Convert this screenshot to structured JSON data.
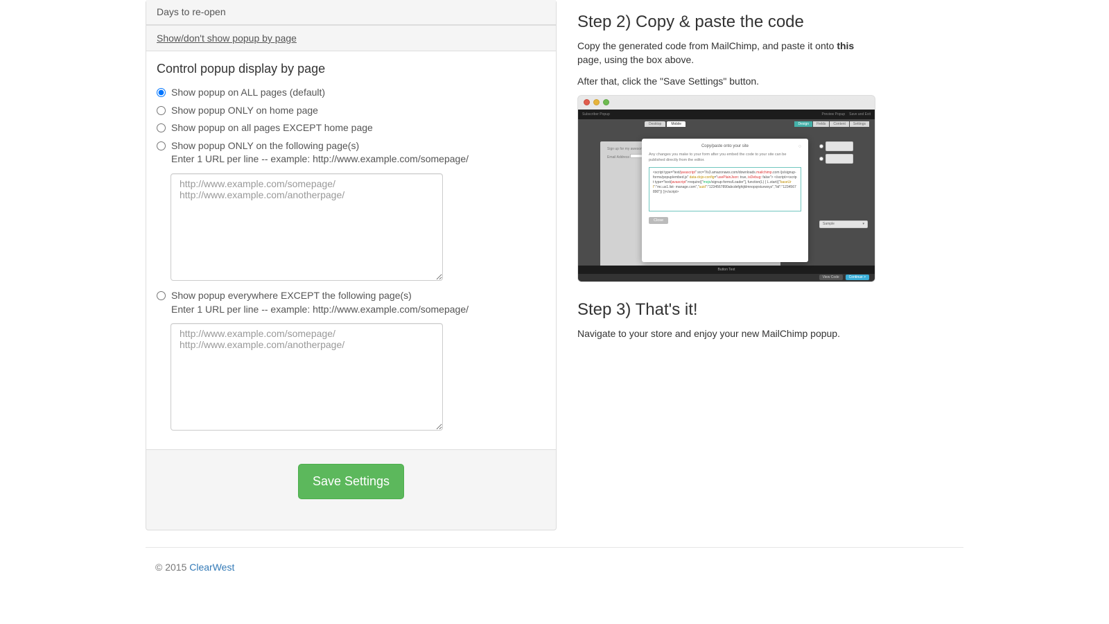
{
  "accordion": {
    "days_label": "Days to re-open",
    "show_hide_label": "Show/don't show popup by page"
  },
  "panel": {
    "heading": "Control popup display by page",
    "radios": {
      "all": "Show popup on ALL pages (default)",
      "home": "Show popup ONLY on home page",
      "except_home": "Show popup on all pages EXCEPT home page",
      "only_pages": "Show popup ONLY on the following page(s)",
      "except_pages": "Show popup everywhere EXCEPT the following page(s)",
      "hint": "Enter 1 URL per line -- example: http://www.example.com/somepage/",
      "placeholder": "http://www.example.com/somepage/\nhttp://www.example.com/anotherpage/"
    }
  },
  "save_button": "Save Settings",
  "step2": {
    "title": "Step 2) Copy & paste the code",
    "p1a": "Copy the generated code from MailChimp, and paste it onto ",
    "p1b": "this",
    "p1c": " page, using the box above.",
    "p2": "After that, click the \"Save Settings\" button."
  },
  "step3": {
    "title": "Step 3) That's it!",
    "p1": "Navigate to your store and enjoy your new MailChimp popup."
  },
  "screenshot": {
    "topbar_left": "Subscriber Popup",
    "topbar_r1": "Preview Popup",
    "topbar_r2": "Save and Exit",
    "tab1": "Desktop",
    "tab2": "Mobile",
    "chip1": "Design",
    "chip2": "Fields",
    "chip3": "Content",
    "chip4": "Settings",
    "panel_r1": "Sign up for my awesome",
    "panel_r2": "Email Address",
    "dropdown": "Sample",
    "bottom": "Button Text",
    "f_btn1": "View Code",
    "f_btn2": "Continue >",
    "modal_title": "Copy/paste onto your site",
    "modal_text": "Any changes you make to your form after you embed the code to your site can be published directly from the editor.",
    "modal_close_btn": "Close",
    "code_l1a": "<script type=\"text/",
    "code_l1b": "javascript",
    "code_l1c": "\" src=\"//s3.amazonaws.com/downloads.",
    "code_l1d": "mailchimp",
    "code_l1e": ".com",
    "code_l2a": "/js/signup-forms/popup/embed.js\" ",
    "code_l2b": "data-dojo-config",
    "code_l2c": "=\"",
    "code_l2d": "usePlainJson",
    "code_l2e": ": true, ",
    "code_l2f": "isDebug",
    "code_l2g": ": false\">",
    "code_l3a": "</script><script type=\"text/",
    "code_l3b": "javascript",
    "code_l3c": "\">require([\"",
    "code_l3d": "mojo",
    "code_l3e": "/signup-forms/Loader\"], function(L)",
    "code_l4a": "{ L.start({\"",
    "code_l4b": "baseUrl",
    "code_l4c": "\":\"mc.us1.list-",
    "code_l5a": "manage.com\",\"",
    "code_l5b": "uuid",
    "code_l5c": "\":\"1234567890abcdefghijklmnopqrstuvwxyz\",\"lid\":\"1234567890\"})",
    "code_l6": "})</script>"
  },
  "footer": {
    "copyright": "© 2015 ",
    "link": "ClearWest"
  }
}
